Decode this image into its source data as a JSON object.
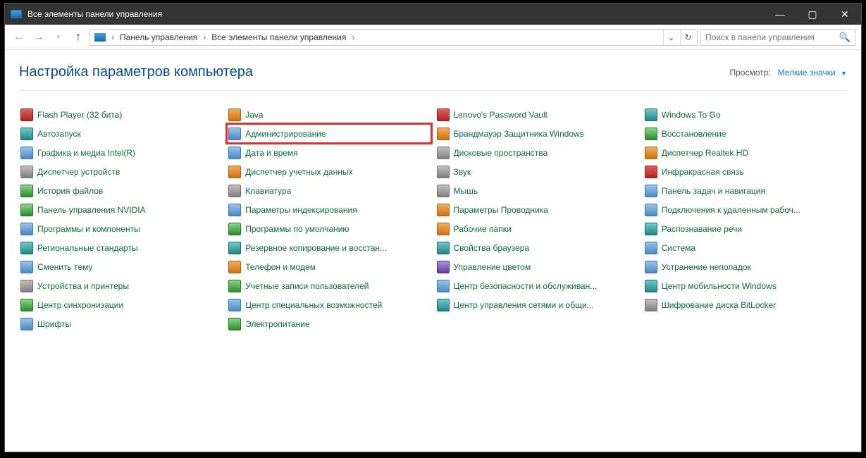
{
  "titlebar": {
    "title": "Все элементы панели управления"
  },
  "nav": {
    "breadcrumb": [
      "Панель управления",
      "Все элементы панели управления"
    ],
    "search_placeholder": "Поиск в панели управления"
  },
  "header": {
    "heading": "Настройка параметров компьютера",
    "view_label": "Просмотр:",
    "view_value": "Мелкие значки"
  },
  "items": [
    {
      "label": "Flash Player (32 бита)",
      "icon": "red"
    },
    {
      "label": "Автозапуск",
      "icon": "teal"
    },
    {
      "label": "Графика и медиа Intel(R)",
      "icon": "blue"
    },
    {
      "label": "Диспетчер устройств",
      "icon": "gray"
    },
    {
      "label": "История файлов",
      "icon": "green"
    },
    {
      "label": "Панель управления NVIDIA",
      "icon": "green"
    },
    {
      "label": "Программы и компоненты",
      "icon": "blue"
    },
    {
      "label": "Региональные стандарты",
      "icon": "teal"
    },
    {
      "label": "Сменить тему",
      "icon": "blue"
    },
    {
      "label": "Устройства и принтеры",
      "icon": "gray"
    },
    {
      "label": "Центр синхронизации",
      "icon": "green"
    },
    {
      "label": "Шрифты",
      "icon": "blue"
    },
    {
      "label": "Java",
      "icon": "orange"
    },
    {
      "label": "Администрирование",
      "icon": "blue",
      "highlight": true
    },
    {
      "label": "Дата и время",
      "icon": "blue"
    },
    {
      "label": "Диспетчер учетных данных",
      "icon": "orange"
    },
    {
      "label": "Клавиатура",
      "icon": "gray"
    },
    {
      "label": "Параметры индексирования",
      "icon": "blue"
    },
    {
      "label": "Программы по умолчанию",
      "icon": "green"
    },
    {
      "label": "Резервное копирование и восстан...",
      "icon": "teal"
    },
    {
      "label": "Телефон и модем",
      "icon": "orange"
    },
    {
      "label": "Учетные записи пользователей",
      "icon": "green"
    },
    {
      "label": "Центр специальных возможностей",
      "icon": "blue"
    },
    {
      "label": "Электропитание",
      "icon": "green"
    },
    {
      "label": "Lenovo's Password Vault",
      "icon": "red"
    },
    {
      "label": "Брандмауэр Защитника Windows",
      "icon": "orange"
    },
    {
      "label": "Дисковые пространства",
      "icon": "gray"
    },
    {
      "label": "Звук",
      "icon": "gray"
    },
    {
      "label": "Мышь",
      "icon": "gray"
    },
    {
      "label": "Параметры Проводника",
      "icon": "orange"
    },
    {
      "label": "Рабочие папки",
      "icon": "orange"
    },
    {
      "label": "Свойства браузера",
      "icon": "teal"
    },
    {
      "label": "Управление цветом",
      "icon": "purple"
    },
    {
      "label": "Центр безопасности и обслуживан...",
      "icon": "blue"
    },
    {
      "label": "Центр управления сетями и общи...",
      "icon": "teal"
    },
    {
      "label": "",
      "icon": "",
      "empty": true
    },
    {
      "label": "Windows To Go",
      "icon": "teal"
    },
    {
      "label": "Восстановление",
      "icon": "green"
    },
    {
      "label": "Диспетчер Realtek HD",
      "icon": "orange"
    },
    {
      "label": "Инфракрасная связь",
      "icon": "red"
    },
    {
      "label": "Панель задач и навигация",
      "icon": "blue"
    },
    {
      "label": "Подключения к удаленным рабоч...",
      "icon": "blue"
    },
    {
      "label": "Распознавание речи",
      "icon": "teal"
    },
    {
      "label": "Система",
      "icon": "blue"
    },
    {
      "label": "Устранение неполадок",
      "icon": "blue"
    },
    {
      "label": "Центр мобильности Windows",
      "icon": "teal"
    },
    {
      "label": "Шифрование диска BitLocker",
      "icon": "gray"
    },
    {
      "label": "",
      "icon": "",
      "empty": true
    }
  ]
}
